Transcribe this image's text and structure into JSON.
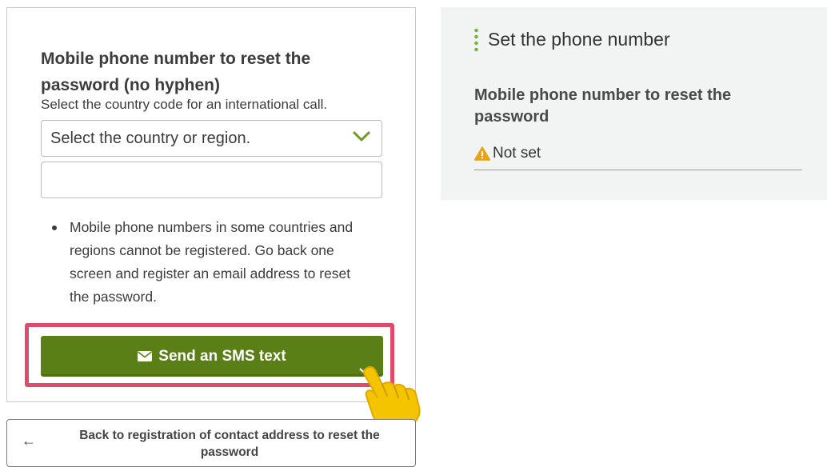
{
  "form": {
    "title": "Mobile phone number to reset the password (no hyphen)",
    "hint": "Select the country code for an international call.",
    "country_select": {
      "selected": "Select the country or region."
    },
    "phone_input": {
      "value": "",
      "placeholder": ""
    },
    "notes": [
      "Mobile phone numbers in some countries and regions cannot be registered. Go back one screen and register an email address to reset the password."
    ],
    "send_button": {
      "label": "Send an SMS text",
      "icon": "envelope-icon"
    }
  },
  "back_button": {
    "label": "Back to registration of contact address to reset the password",
    "icon": "arrow-left-icon"
  },
  "summary": {
    "heading": "Set the phone number",
    "field_label": "Mobile phone number to reset the password",
    "status": "Not set",
    "status_icon": "warning-icon"
  },
  "colors": {
    "accent_green": "#5a7f17",
    "highlight": "#e04a6b",
    "chevron": "#6a9a1f",
    "warning": "#e8a317",
    "panel_bg": "#f2f4f4"
  }
}
